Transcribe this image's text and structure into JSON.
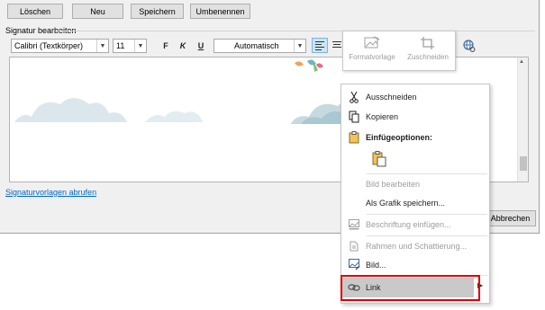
{
  "top_buttons": {
    "delete": "Löschen",
    "new": "Neu",
    "save": "Speichern",
    "rename": "Umbenennen"
  },
  "signature_section": {
    "label": "Signatur bearbeiten"
  },
  "formatting": {
    "font": "Calibri (Textkörper)",
    "size": "11",
    "bold": "F",
    "italic": "K",
    "underline": "U",
    "color": "Automatisch"
  },
  "picture_toolbar": {
    "style": "Formatvorlage",
    "crop": "Zuschneiden"
  },
  "context_menu": {
    "cut": "Ausschneiden",
    "copy": "Kopieren",
    "paste_options": "Einfügeoptionen:",
    "edit_picture": "Bild bearbeiten",
    "save_as_picture": "Als Grafik speichern...",
    "insert_caption": "Beschriftung einfügen...",
    "borders_shading": "Rahmen und Schattierung...",
    "picture": "Bild...",
    "link": "Link"
  },
  "footer": {
    "templates_link": "Signaturvorlagen abrufen",
    "cancel": "Abbrechen"
  },
  "colors": {
    "dialog_bg": "#f0f0f0",
    "link": "#0066cc",
    "highlight": "#e00000",
    "cloud": "#c6d9df",
    "cloud_dark": "#a8c8d3"
  }
}
